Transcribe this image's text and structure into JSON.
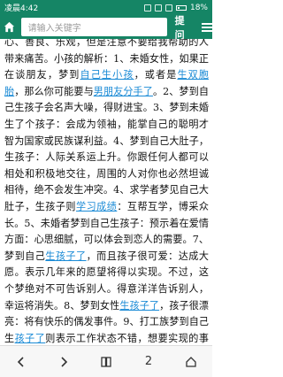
{
  "status": {
    "time": "凌晨4:42",
    "battery": "18%"
  },
  "topbar": {
    "search_placeholder": "请输入关键字",
    "submit_label": "提问"
  },
  "article": {
    "segments": [
      {
        "t": "心、善良、乐观，但是注意不要给我帮助的人带来痛苦。",
        "link": false
      },
      {
        "t": "小孩的解析：1、未婚女性，如果正在谈朋友，梦到",
        "link": false
      },
      {
        "t": "自己生小孩",
        "link": true
      },
      {
        "t": "，或者是",
        "link": false
      },
      {
        "t": "生双胞胎",
        "link": true
      },
      {
        "t": "，那么你可能要与",
        "link": false
      },
      {
        "t": "男朋友分手了",
        "link": true
      },
      {
        "t": "。2、梦到自己生孩子会名声大噪，得财进宝。3、梦到未婚生了个孩子：会成为领袖，能掌自己的聪明才智为国家或民族谋利益。4、梦到自己大肚子，生孩子：人际关系运上升。你跟任何人都可以相处和积极地交往，周围的人对你也必然坦诚相待，绝不会发生冲突。4、求学者梦见自己大肚子，生孩子则",
        "link": false
      },
      {
        "t": "学习成绩",
        "link": true
      },
      {
        "t": "：互帮互学，博采众长。5、未婚者梦到自己生孩子：预示着在爱情方面：心思细腻，可以体会到恋人的需要。7、梦到自己",
        "link": false
      },
      {
        "t": "生孩子了",
        "link": true
      },
      {
        "t": "，而且孩子很可爱：达成大愿。表示几年来的愿望将得以实现。不过，这个梦绝对不可告诉别人。得意洋洋告诉别人，幸运将消失。8、梦到女性",
        "link": false
      },
      {
        "t": "生孩子了",
        "link": true
      },
      {
        "t": "，孩子很漂亮：将有快乐的偶发事件。9、打工族梦到自己生",
        "link": false
      },
      {
        "t": "孩子了",
        "link": true
      },
      {
        "t": "则表示工作状态不错，想要实现的事情能够得以顺利进行。",
        "link": false
      }
    ]
  },
  "bottom": {
    "page_number": "2"
  },
  "colors": {
    "header": "#158565",
    "link": "#1b8bd6"
  }
}
